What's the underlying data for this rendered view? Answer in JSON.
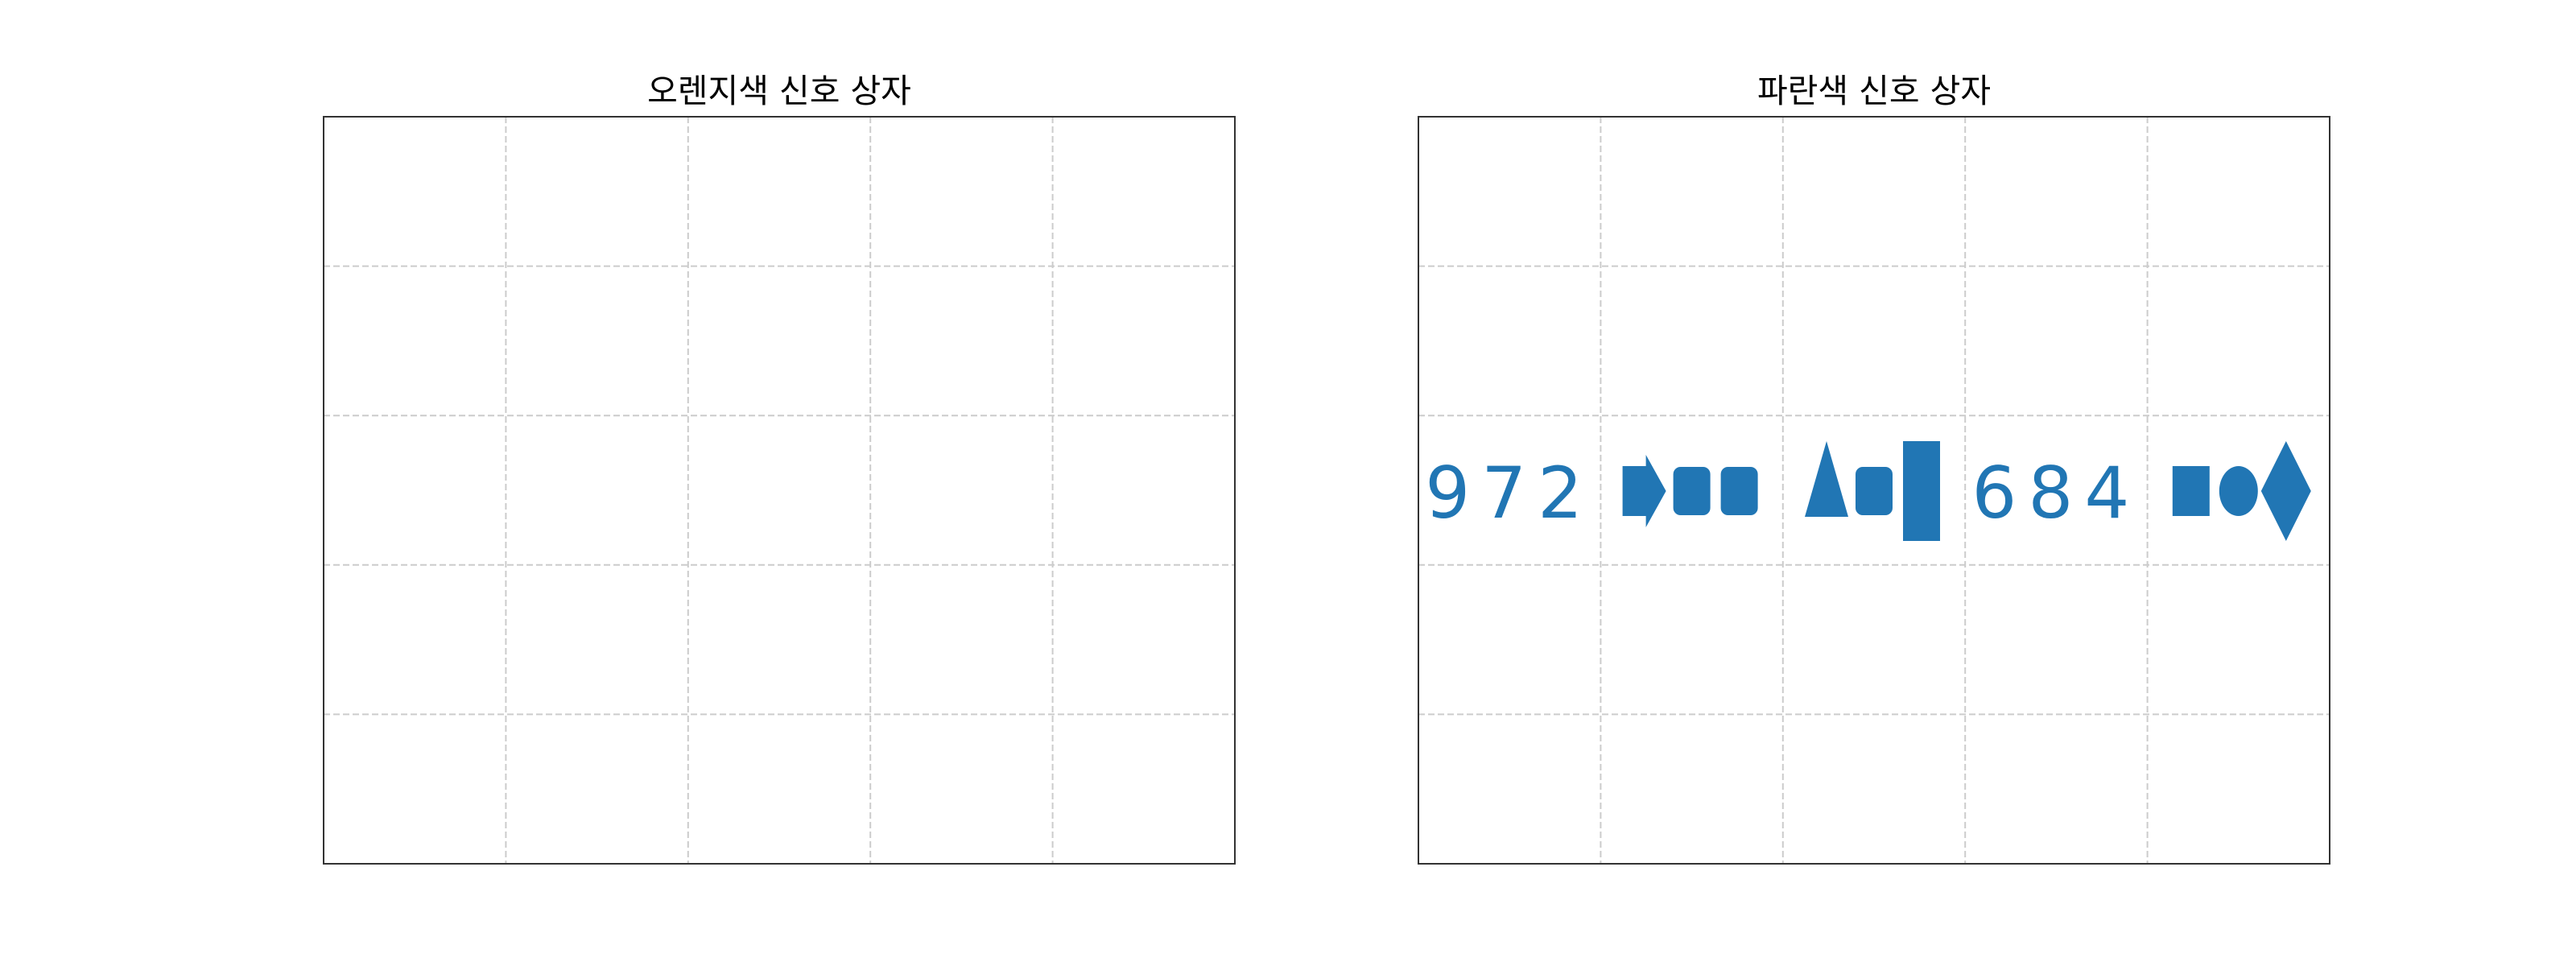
{
  "colors": {
    "signal": "#2176b4",
    "grid": "#cccccc",
    "frame": "#333333",
    "background": "#ffffff"
  },
  "chart_data": [
    {
      "type": "other",
      "title": "오렌지색 신호 상자",
      "grid": true,
      "grid_cells": [
        5,
        5
      ],
      "signals": []
    },
    {
      "type": "other",
      "title": "파란색 신호 상자",
      "grid": true,
      "grid_cells": [
        5,
        5
      ],
      "signals": [
        {
          "kind": "digits",
          "text": "972"
        },
        {
          "kind": "shapes",
          "shapes": [
            "arrow",
            "rounded-square",
            "rounded-square"
          ]
        },
        {
          "kind": "shapes",
          "shapes": [
            "triangle",
            "rounded-square",
            "tall-rectangle"
          ]
        },
        {
          "kind": "digits",
          "text": "684"
        },
        {
          "kind": "shapes",
          "shapes": [
            "square",
            "circle",
            "diamond"
          ]
        }
      ]
    }
  ]
}
